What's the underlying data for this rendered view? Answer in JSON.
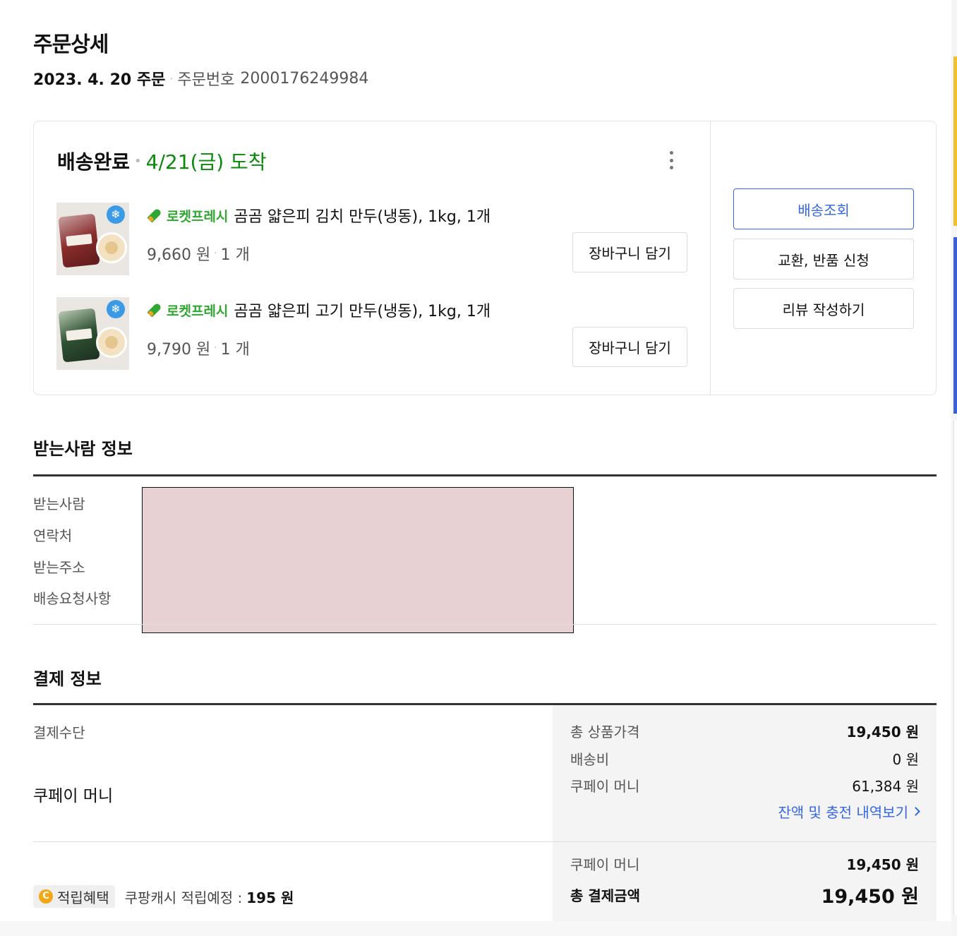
{
  "header": {
    "title": "주문상세",
    "order_date": "2023. 4. 20 주문",
    "order_number_label": "주문번호",
    "order_number": "2000176249984"
  },
  "shipment": {
    "status": "배송완료",
    "arrival": "4/21(금) 도착",
    "items": [
      {
        "badge": "로켓프레시",
        "name": "곰곰 얇은피 김치 만두(냉동), 1kg, 1개",
        "price": "9,660 원",
        "qty": "1 개",
        "cart_button": "장바구니 담기",
        "thumb_icon": "frozen-dumpling-kimchi",
        "freeze_icon": "❄"
      },
      {
        "badge": "로켓프레시",
        "name": "곰곰 얇은피 고기 만두(냉동), 1kg, 1개",
        "price": "9,790 원",
        "qty": "1 개",
        "cart_button": "장바구니 담기",
        "thumb_icon": "frozen-dumpling-meat",
        "freeze_icon": "❄"
      }
    ],
    "actions": {
      "track": "배송조회",
      "return": "교환, 반품 신청",
      "review": "리뷰 작성하기"
    }
  },
  "recipient": {
    "title": "받는사람 정보",
    "labels": [
      "받는사람",
      "연락처",
      "받는주소",
      "배송요청사항"
    ]
  },
  "payment": {
    "title": "결제 정보",
    "method_label": "결제수단",
    "method_value": "쿠페이 머니",
    "summary": {
      "total_product_label": "총 상품가격",
      "total_product_value": "19,450 원",
      "shipping_label": "배송비",
      "shipping_value": "0 원",
      "coupay_label": "쿠페이 머니",
      "coupay_balance": "61,384 원",
      "history_link": "잔액 및 충전 내역보기",
      "coupay_paid_label": "쿠페이 머니",
      "coupay_paid_value": "19,450 원",
      "total_paid_label": "총 결제금액",
      "total_paid_value": "19,450 원"
    },
    "reward": {
      "coin": "C",
      "badge": "적립혜택",
      "text": "쿠팡캐시 적립예정 :",
      "amount": "195 원"
    }
  },
  "colors": {
    "accent_blue": "#3466e6",
    "arrival_green": "#0a8a0a",
    "rocket_green": "#2ea830",
    "coin_gold": "#f0a814"
  }
}
